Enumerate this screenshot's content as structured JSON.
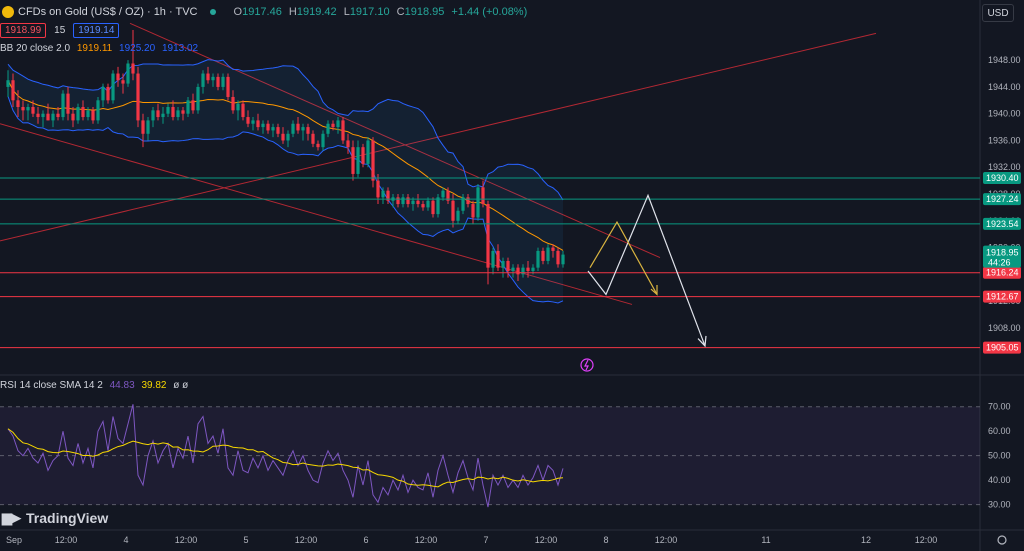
{
  "header": {
    "symbol": "CFDs on Gold (US$ / OZ) · 1h · TVC",
    "ohlc": [
      {
        "label": "O",
        "value": "1917.46"
      },
      {
        "label": "H",
        "value": "1919.42"
      },
      {
        "label": "L",
        "value": "1917.10"
      },
      {
        "label": "C",
        "value": "1918.95"
      }
    ],
    "change": "+1.44 (+0.08%)",
    "sell_price": "1918.99",
    "spread": "15",
    "buy_price": "1919.14",
    "currency": "USD"
  },
  "indicators": {
    "bb_label": "BB 20 close 2.0",
    "bb_values": [
      "1919.11",
      "1925.20",
      "1913.02"
    ],
    "rsi_label": "RSI 14 close SMA 14 2",
    "rsi_values": [
      "44.83",
      "39.82"
    ],
    "rsi_extra": "ø  ø"
  },
  "brand": "TradingView",
  "chart_data": {
    "type": "candlestick",
    "price_axis": {
      "ticks": [
        1948.0,
        1944.0,
        1940.0,
        1936.0,
        1932.0,
        1928.0,
        1924.0,
        1920.0,
        1916.0,
        1912.0,
        1908.0
      ],
      "ylim": [
        1903.5,
        1954.0
      ]
    },
    "rsi_axis": {
      "ticks": [
        70.0,
        60.0,
        50.0,
        40.0,
        30.0
      ],
      "ylim": [
        27,
        76
      ]
    },
    "x_axis": {
      "ticks": [
        {
          "label": "Sep",
          "t": 0
        },
        {
          "label": "12:00",
          "t": 12
        },
        {
          "label": "4",
          "t": 24
        },
        {
          "label": "12:00",
          "t": 36
        },
        {
          "label": "5",
          "t": 48
        },
        {
          "label": "12:00",
          "t": 60
        },
        {
          "label": "6",
          "t": 72
        },
        {
          "label": "12:00",
          "t": 84
        },
        {
          "label": "7",
          "t": 96
        },
        {
          "label": "12:00",
          "t": 108
        },
        {
          "label": "8",
          "t": 120
        },
        {
          "label": "12:00",
          "t": 132
        },
        {
          "label": "11",
          "t": 152
        },
        {
          "label": "12",
          "t": 172
        },
        {
          "label": "12:00",
          "t": 184
        }
      ]
    },
    "levels": [
      {
        "label": "1930.40",
        "value": 1930.4,
        "color": "#089981"
      },
      {
        "label": "1927.24",
        "value": 1927.24,
        "color": "#089981"
      },
      {
        "label": "1923.54",
        "value": 1923.54,
        "color": "#089981"
      },
      {
        "label": "1916.24",
        "value": 1916.24,
        "color": "#f23645"
      },
      {
        "label": "1912.67",
        "value": 1912.67,
        "color": "#f23645"
      },
      {
        "label": "1905.05",
        "value": 1905.05,
        "color": "#f23645"
      }
    ],
    "last_price": {
      "label": "1918.95",
      "countdown": "44:26",
      "value": 1918.95,
      "color": "#089981"
    },
    "candles": [
      [
        1944.0,
        1946.5,
        1942.5,
        1945.0
      ],
      [
        1945.0,
        1946.0,
        1941.0,
        1942.0
      ],
      [
        1942.0,
        1943.5,
        1939.5,
        1941.0
      ],
      [
        1941.0,
        1942.0,
        1939.0,
        1940.5
      ],
      [
        1940.5,
        1941.5,
        1939.0,
        1941.0
      ],
      [
        1941.0,
        1942.0,
        1939.5,
        1940.0
      ],
      [
        1940.0,
        1941.0,
        1938.5,
        1939.5
      ],
      [
        1939.5,
        1940.5,
        1938.0,
        1940.0
      ],
      [
        1940.0,
        1941.5,
        1939.0,
        1939.0
      ],
      [
        1939.0,
        1940.5,
        1938.0,
        1940.0
      ],
      [
        1940.0,
        1941.0,
        1939.0,
        1939.5
      ],
      [
        1939.5,
        1943.5,
        1939.0,
        1943.0
      ],
      [
        1943.0,
        1944.0,
        1939.0,
        1940.0
      ],
      [
        1940.0,
        1941.0,
        1938.0,
        1939.0
      ],
      [
        1939.0,
        1941.5,
        1938.5,
        1941.0
      ],
      [
        1941.0,
        1942.0,
        1939.0,
        1939.5
      ],
      [
        1939.5,
        1941.0,
        1939.0,
        1940.5
      ],
      [
        1940.5,
        1941.0,
        1938.5,
        1939.0
      ],
      [
        1939.0,
        1942.5,
        1938.5,
        1942.0
      ],
      [
        1942.0,
        1944.5,
        1941.0,
        1944.0
      ],
      [
        1944.0,
        1944.5,
        1941.5,
        1942.0
      ],
      [
        1942.0,
        1946.5,
        1941.5,
        1946.0
      ],
      [
        1946.0,
        1947.0,
        1944.0,
        1945.0
      ],
      [
        1945.0,
        1946.0,
        1943.0,
        1944.5
      ],
      [
        1944.5,
        1948.0,
        1944.0,
        1947.5
      ],
      [
        1947.5,
        1952.5,
        1945.0,
        1946.0
      ],
      [
        1946.0,
        1947.0,
        1938.0,
        1939.0
      ],
      [
        1939.0,
        1940.0,
        1935.0,
        1937.0
      ],
      [
        1937.0,
        1939.5,
        1936.0,
        1939.0
      ],
      [
        1939.0,
        1941.0,
        1938.0,
        1940.5
      ],
      [
        1940.5,
        1941.5,
        1939.0,
        1939.5
      ],
      [
        1939.5,
        1941.0,
        1938.5,
        1940.0
      ],
      [
        1940.0,
        1941.5,
        1939.5,
        1941.0
      ],
      [
        1941.0,
        1942.0,
        1939.0,
        1939.5
      ],
      [
        1939.5,
        1941.0,
        1939.0,
        1940.5
      ],
      [
        1940.5,
        1941.0,
        1939.0,
        1940.0
      ],
      [
        1940.0,
        1942.5,
        1939.5,
        1942.0
      ],
      [
        1942.0,
        1943.0,
        1940.0,
        1940.5
      ],
      [
        1940.5,
        1944.5,
        1940.0,
        1944.0
      ],
      [
        1944.0,
        1946.5,
        1943.0,
        1946.0
      ],
      [
        1946.0,
        1947.0,
        1944.5,
        1945.0
      ],
      [
        1945.0,
        1946.0,
        1944.0,
        1945.5
      ],
      [
        1945.5,
        1946.0,
        1943.5,
        1944.0
      ],
      [
        1944.0,
        1946.0,
        1943.5,
        1945.5
      ],
      [
        1945.5,
        1946.0,
        1942.0,
        1942.5
      ],
      [
        1942.5,
        1943.5,
        1940.0,
        1940.5
      ],
      [
        1940.5,
        1942.0,
        1939.0,
        1941.5
      ],
      [
        1941.5,
        1942.0,
        1939.0,
        1939.5
      ],
      [
        1939.5,
        1940.5,
        1938.0,
        1938.5
      ],
      [
        1938.5,
        1939.5,
        1937.5,
        1939.0
      ],
      [
        1939.0,
        1940.0,
        1937.5,
        1938.0
      ],
      [
        1938.0,
        1939.0,
        1937.0,
        1938.5
      ],
      [
        1938.5,
        1939.0,
        1937.0,
        1937.5
      ],
      [
        1937.5,
        1938.5,
        1936.5,
        1938.0
      ],
      [
        1938.0,
        1938.5,
        1936.5,
        1937.0
      ],
      [
        1937.0,
        1938.0,
        1935.5,
        1936.0
      ],
      [
        1936.0,
        1937.5,
        1935.0,
        1937.0
      ],
      [
        1937.0,
        1939.0,
        1936.5,
        1938.5
      ],
      [
        1938.5,
        1939.5,
        1937.0,
        1937.5
      ],
      [
        1937.5,
        1938.5,
        1936.0,
        1938.0
      ],
      [
        1938.0,
        1938.5,
        1936.0,
        1937.0
      ],
      [
        1937.0,
        1937.5,
        1935.0,
        1935.5
      ],
      [
        1935.5,
        1936.0,
        1934.5,
        1935.0
      ],
      [
        1935.0,
        1937.5,
        1934.5,
        1937.0
      ],
      [
        1937.0,
        1939.0,
        1936.5,
        1938.5
      ],
      [
        1938.5,
        1939.0,
        1937.5,
        1938.0
      ],
      [
        1938.0,
        1939.5,
        1937.0,
        1939.0
      ],
      [
        1939.0,
        1939.5,
        1935.5,
        1936.0
      ],
      [
        1936.0,
        1937.0,
        1934.0,
        1935.0
      ],
      [
        1935.0,
        1936.0,
        1930.0,
        1931.0
      ],
      [
        1931.0,
        1936.0,
        1930.5,
        1935.0
      ],
      [
        1935.0,
        1935.5,
        1932.0,
        1932.5
      ],
      [
        1932.5,
        1936.5,
        1932.0,
        1936.0
      ],
      [
        1936.0,
        1936.5,
        1929.0,
        1930.0
      ],
      [
        1930.0,
        1931.0,
        1926.5,
        1927.5
      ],
      [
        1927.5,
        1929.0,
        1926.5,
        1928.5
      ],
      [
        1928.5,
        1929.0,
        1926.5,
        1927.0
      ],
      [
        1927.0,
        1928.0,
        1926.0,
        1927.5
      ],
      [
        1927.5,
        1928.0,
        1926.0,
        1926.5
      ],
      [
        1926.5,
        1928.0,
        1926.0,
        1927.5
      ],
      [
        1927.5,
        1928.0,
        1926.0,
        1926.5
      ],
      [
        1926.5,
        1927.5,
        1925.5,
        1927.0
      ],
      [
        1927.0,
        1928.0,
        1926.0,
        1926.5
      ],
      [
        1926.5,
        1927.0,
        1925.5,
        1926.0
      ],
      [
        1926.0,
        1927.5,
        1925.5,
        1927.0
      ],
      [
        1927.0,
        1927.5,
        1924.5,
        1925.0
      ],
      [
        1925.0,
        1928.0,
        1924.5,
        1927.5
      ],
      [
        1927.5,
        1929.0,
        1927.0,
        1928.5
      ],
      [
        1928.5,
        1929.0,
        1926.5,
        1927.0
      ],
      [
        1927.0,
        1928.0,
        1923.0,
        1924.0
      ],
      [
        1924.0,
        1926.0,
        1923.5,
        1925.5
      ],
      [
        1925.5,
        1928.0,
        1925.0,
        1927.5
      ],
      [
        1927.5,
        1928.0,
        1926.0,
        1926.5
      ],
      [
        1926.5,
        1927.0,
        1923.5,
        1924.5
      ],
      [
        1924.5,
        1929.5,
        1924.0,
        1929.0
      ],
      [
        1929.0,
        1930.0,
        1926.0,
        1926.5
      ],
      [
        1926.5,
        1927.0,
        1914.5,
        1917.0
      ],
      [
        1917.0,
        1920.0,
        1916.0,
        1919.5
      ],
      [
        1919.5,
        1920.5,
        1916.5,
        1917.0
      ],
      [
        1917.0,
        1918.5,
        1915.5,
        1918.0
      ],
      [
        1918.0,
        1918.5,
        1915.5,
        1916.5
      ],
      [
        1916.5,
        1917.5,
        1915.5,
        1917.0
      ],
      [
        1917.0,
        1917.5,
        1915.0,
        1916.0
      ],
      [
        1916.0,
        1917.5,
        1915.5,
        1917.0
      ],
      [
        1917.0,
        1918.0,
        1915.5,
        1916.5
      ],
      [
        1916.5,
        1917.5,
        1916.0,
        1917.0
      ],
      [
        1917.0,
        1920.0,
        1916.5,
        1919.5
      ],
      [
        1919.5,
        1920.0,
        1917.5,
        1918.0
      ],
      [
        1918.0,
        1920.5,
        1917.5,
        1920.0
      ],
      [
        1920.0,
        1920.5,
        1918.5,
        1919.5
      ],
      [
        1919.5,
        1920.0,
        1917.0,
        1917.5
      ],
      [
        1917.5,
        1919.5,
        1917.0,
        1918.95
      ]
    ],
    "rsi": [
      61,
      58,
      52,
      50,
      53,
      49,
      47,
      51,
      44,
      48,
      50,
      60,
      49,
      46,
      55,
      47,
      53,
      45,
      60,
      64,
      52,
      66,
      57,
      55,
      63,
      71,
      42,
      38,
      50,
      56,
      47,
      52,
      55,
      45,
      53,
      49,
      58,
      47,
      63,
      66,
      55,
      58,
      51,
      61,
      45,
      42,
      52,
      44,
      43,
      49,
      45,
      50,
      44,
      48,
      45,
      42,
      48,
      52,
      46,
      50,
      44,
      40,
      39,
      47,
      52,
      48,
      51,
      44,
      40,
      33,
      46,
      38,
      48,
      34,
      31,
      37,
      34,
      40,
      36,
      42,
      35,
      40,
      37,
      36,
      43,
      33,
      44,
      50,
      42,
      35,
      43,
      48,
      41,
      36,
      49,
      38,
      29,
      42,
      38,
      42,
      37,
      40,
      37,
      42,
      38,
      41,
      46,
      40,
      46,
      44,
      38,
      44.83
    ],
    "annotations": {
      "white_path": [
        [
          1916.5
        ],
        [
          1913.0
        ],
        [
          1927.8
        ],
        [
          1905.3
        ]
      ],
      "yellow_path": [
        [
          1917.0
        ],
        [
          1923.8
        ],
        [
          1913.0
        ]
      ]
    }
  }
}
